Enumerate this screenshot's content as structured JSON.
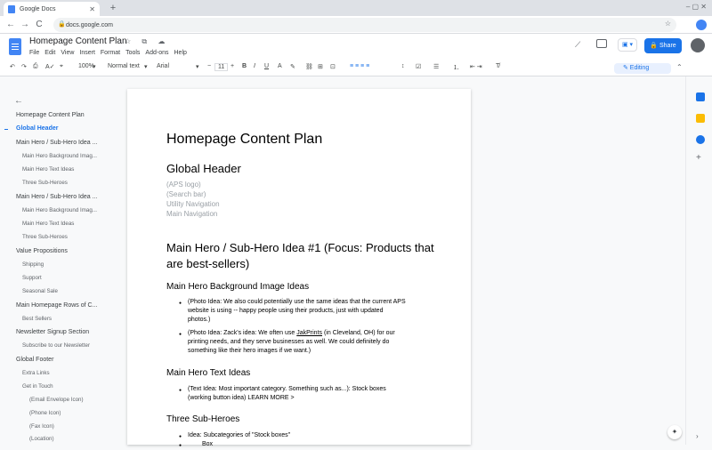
{
  "browser": {
    "tab_title": "Google Docs",
    "tab_close": "✕",
    "new_tab": "+",
    "url": "docs.google.com",
    "window_controls": "–  ▢  ✕",
    "back": "←",
    "forward": "→",
    "reload": "C",
    "lock": "🔒",
    "star": "☆"
  },
  "doc": {
    "title": "Homepage Content Plan",
    "title_icons": "☆ ⧉ ☁",
    "menu": [
      "File",
      "Edit",
      "View",
      "Insert",
      "Format",
      "Tools",
      "Add-ons",
      "Help"
    ],
    "share_label": "Share",
    "meet_label": "▣ ▾",
    "trend_icon": "⟋"
  },
  "toolbar": {
    "undo": "↶",
    "redo": "↷",
    "print": "⎙",
    "spell": "A✓",
    "paint": "⌖",
    "zoom": "100%",
    "style": "Normal text",
    "font": "Arial",
    "minus": "−",
    "size": "11",
    "plus": "+",
    "bold": "B",
    "italic": "I",
    "underline": "U",
    "color": "A",
    "highlight": "✎",
    "link": "⛓",
    "comment": "⊞",
    "image": "⊡",
    "align": "≡  ≡  ≡  ≡",
    "spacing": "↕",
    "checklist": "☑",
    "bullets": "☰",
    "numbers": "⒈",
    "indent": "⇤  ⇥",
    "clear": "T̸",
    "editing": "✎ Editing",
    "collapse": "⌃"
  },
  "outline": {
    "back": "←",
    "items": [
      {
        "label": "Homepage Content Plan",
        "level": 1
      },
      {
        "label": "Global Header",
        "level": 1,
        "active": true
      },
      {
        "label": "Main Hero / Sub-Hero Idea ...",
        "level": 1
      },
      {
        "label": "Main Hero Background Imag...",
        "level": 2
      },
      {
        "label": "Main Hero Text Ideas",
        "level": 2
      },
      {
        "label": "Three Sub-Heroes",
        "level": 2
      },
      {
        "label": "Main Hero / Sub-Hero Idea ...",
        "level": 1
      },
      {
        "label": "Main Hero Background Imag...",
        "level": 2
      },
      {
        "label": "Main Hero Text Ideas",
        "level": 2
      },
      {
        "label": "Three Sub-Heroes",
        "level": 2
      },
      {
        "label": "Value Propositions",
        "level": 1
      },
      {
        "label": "Shipping",
        "level": 2
      },
      {
        "label": "Support",
        "level": 2
      },
      {
        "label": "Seasonal Sale",
        "level": 2
      },
      {
        "label": "Main Homepage Rows of C...",
        "level": 1
      },
      {
        "label": "Best Sellers",
        "level": 2
      },
      {
        "label": "Newsletter Signup Section",
        "level": 1
      },
      {
        "label": "Subscribe to our Newsletter",
        "level": 2
      },
      {
        "label": "Global Footer",
        "level": 1
      },
      {
        "label": "Extra Links",
        "level": 2
      },
      {
        "label": "Get in Touch",
        "level": 2
      },
      {
        "label": "(Email Envelope Icon)",
        "level": 3
      },
      {
        "label": "(Phone Icon)",
        "level": 3
      },
      {
        "label": "(Fax Icon)",
        "level": 3
      },
      {
        "label": "(Location)",
        "level": 3
      }
    ]
  },
  "page": {
    "title": "Homepage Content Plan",
    "global_header": "Global Header",
    "header_items": [
      "(APS logo)",
      "(Search bar)",
      "Utility Navigation",
      "Main Navigation"
    ],
    "hero1_line1": "Main Hero / Sub-Hero Idea #1 (Focus: Products that",
    "hero1_line2": "are best-sellers)",
    "bg_heading": "Main Hero Background Image Ideas",
    "bullet1": "(Photo Idea: We also could potentially use the same ideas that the current APS website is using -- happy people using their products, just with updated photos.)",
    "bullet2_pre": "(Photo Idea: Zack's idea: We often use ",
    "bullet2_link": "JakPrints",
    "bullet2_post": " (in Cleveland, OH) for our printing needs, and they serve businesses as well. We could definitely do something like their hero images if we want.)",
    "text_heading": "Main Hero Text Ideas",
    "bullet3": "(Text Idea: Most important category. Something such as...): Stock boxes (working button idea) LEARN MORE >",
    "sub_heading": "Three Sub-Heroes",
    "bullet4": "Idea: Subcategories of \"Stock boxes\"",
    "bullet5": "Box"
  },
  "rail": {
    "calendar": "calendar-icon",
    "keep": "keep-icon",
    "tasks": "tasks-icon",
    "add": "+",
    "explore": "✦",
    "chevron": "›"
  }
}
